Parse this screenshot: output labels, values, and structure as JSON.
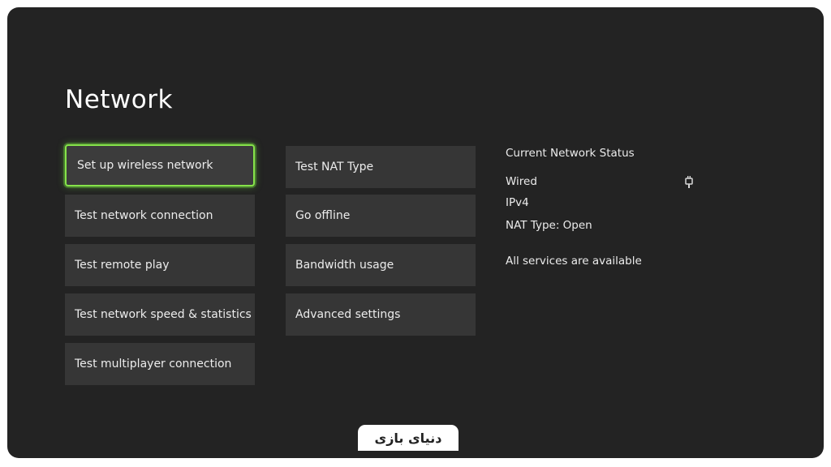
{
  "page": {
    "title": "Network"
  },
  "menu_left": [
    {
      "label": "Set up wireless network",
      "focused": true
    },
    {
      "label": "Test network connection"
    },
    {
      "label": "Test remote play"
    },
    {
      "label": "Test network speed & statistics"
    },
    {
      "label": "Test multiplayer connection"
    }
  ],
  "menu_right": [
    {
      "label": "Test NAT Type"
    },
    {
      "label": "Go offline"
    },
    {
      "label": "Bandwidth usage"
    },
    {
      "label": "Advanced settings"
    }
  ],
  "status": {
    "heading": "Current Network Status",
    "connection": "Wired",
    "connection_icon": "ethernet-plug-icon",
    "ip_version": "IPv4",
    "nat_type": "NAT Type: Open",
    "services": "All services are available"
  },
  "watermark": {
    "text": "دنیای بازی",
    "brand_color": "#e2231a"
  },
  "colors": {
    "focus_outline": "#86e34a",
    "background": "#232323",
    "tile": "#363636"
  }
}
